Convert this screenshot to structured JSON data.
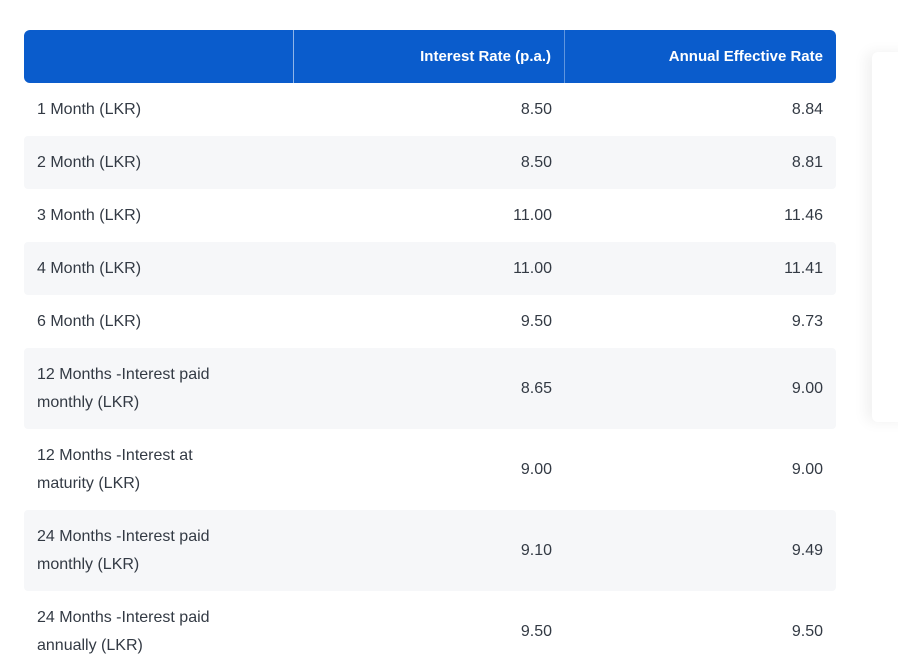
{
  "table": {
    "headers": [
      "",
      "Interest Rate (p.a.)",
      "Annual Effective Rate"
    ],
    "rows": [
      {
        "term": "1 Month (LKR)",
        "interest_rate": "8.50",
        "effective_rate": "8.84"
      },
      {
        "term": "2 Month (LKR)",
        "interest_rate": "8.50",
        "effective_rate": "8.81"
      },
      {
        "term": "3 Month (LKR)",
        "interest_rate": "11.00",
        "effective_rate": "11.46"
      },
      {
        "term": "4 Month (LKR)",
        "interest_rate": "11.00",
        "effective_rate": "11.41"
      },
      {
        "term": "6 Month (LKR)",
        "interest_rate": "9.50",
        "effective_rate": "9.73"
      },
      {
        "term": "12 Months -Interest paid monthly (LKR)",
        "interest_rate": "8.65",
        "effective_rate": "9.00"
      },
      {
        "term": "12 Months -Interest at maturity (LKR)",
        "interest_rate": "9.00",
        "effective_rate": "9.00"
      },
      {
        "term": "24 Months -Interest paid monthly (LKR)",
        "interest_rate": "9.10",
        "effective_rate": "9.49"
      },
      {
        "term": "24 Months -Interest paid annually (LKR)",
        "interest_rate": "9.50",
        "effective_rate": "9.50"
      }
    ]
  },
  "colors": {
    "header_background": "#0a5ccc",
    "header_text": "#ffffff",
    "row_alt_background": "#f6f7f9",
    "body_text": "#333a44"
  }
}
